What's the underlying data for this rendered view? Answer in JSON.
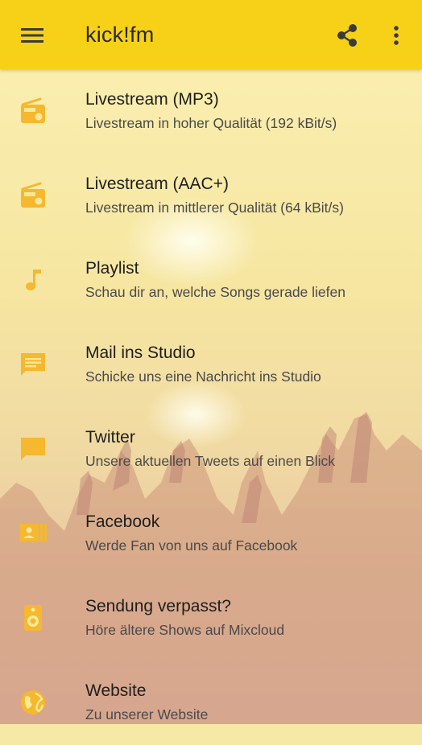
{
  "app": {
    "title": "kick!fm",
    "accent_color": "#F7D117",
    "icon_color": "#F5B82E"
  },
  "toolbar": {
    "menu_icon": "menu-icon",
    "share_icon": "share-icon",
    "more_icon": "more-vert-icon"
  },
  "items": [
    {
      "title": "Livestream (MP3)",
      "subtitle": "Livestream in hoher Qualität (192 kBit/s)",
      "icon": "radio-icon"
    },
    {
      "title": "Livestream (AAC+)",
      "subtitle": "Livestream in mittlerer Qualität (64 kBit/s)",
      "icon": "radio-icon"
    },
    {
      "title": "Playlist",
      "subtitle": "Schau dir an, welche Songs gerade liefen",
      "icon": "music-note-icon"
    },
    {
      "title": "Mail ins Studio",
      "subtitle": "Schicke uns eine Nachricht ins Studio",
      "icon": "message-icon"
    },
    {
      "title": "Twitter",
      "subtitle": "Unsere aktuellen Tweets auf einen Blick",
      "icon": "chat-bubble-icon"
    },
    {
      "title": "Facebook",
      "subtitle": "Werde Fan von uns auf Facebook",
      "icon": "contacts-icon"
    },
    {
      "title": "Sendung verpasst?",
      "subtitle": "Höre ältere Shows auf Mixcloud",
      "icon": "speaker-icon"
    },
    {
      "title": "Website",
      "subtitle": "Zu unserer Website",
      "icon": "globe-icon"
    }
  ]
}
